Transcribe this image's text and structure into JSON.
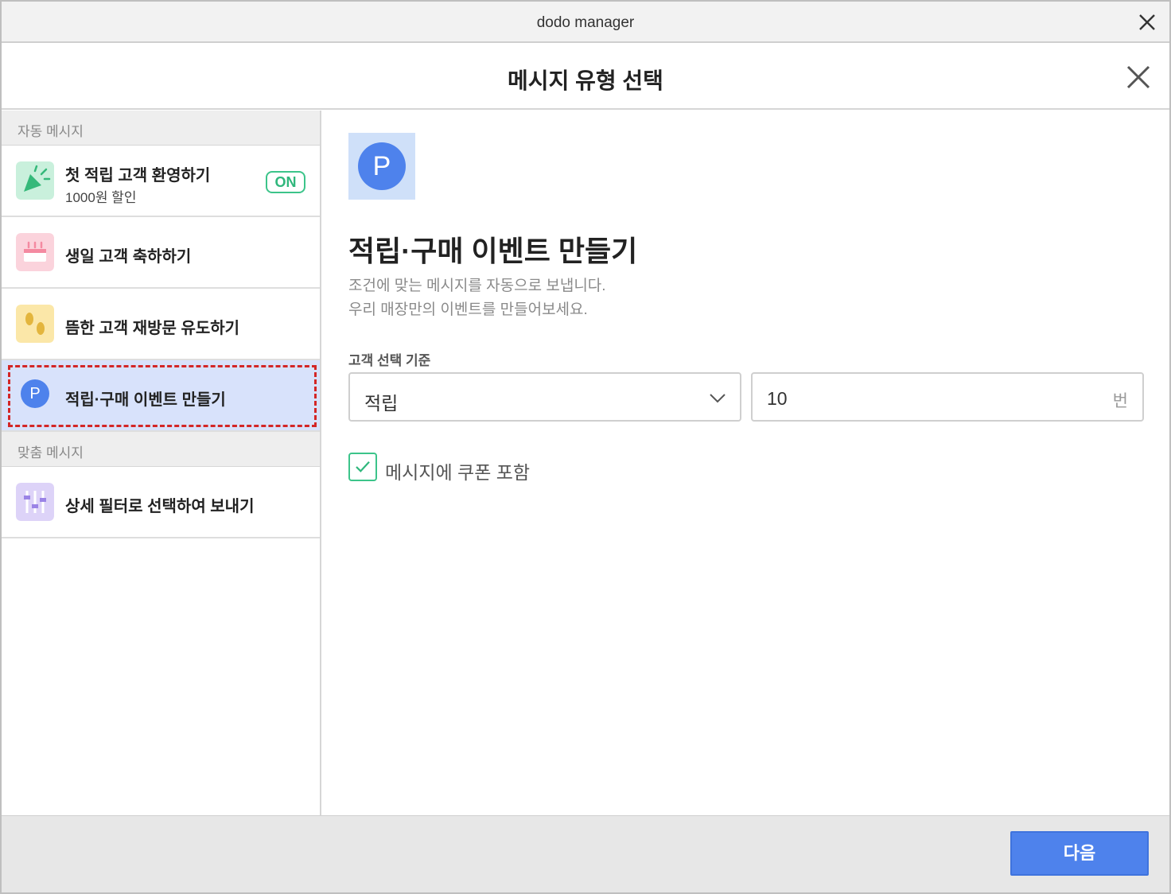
{
  "window": {
    "title": "dodo manager"
  },
  "dialog": {
    "title": "메시지 유형 선택"
  },
  "sidebar": {
    "auto_section": "자동 메시지",
    "custom_section": "맞춤 메시지",
    "items": [
      {
        "label": "첫 적립 고객 환영하기",
        "sub": "1000원 할인",
        "badge": "ON",
        "icon": "party-popper-icon"
      },
      {
        "label": "생일 고객 축하하기",
        "icon": "birthday-cake-icon"
      },
      {
        "label": "뜸한 고객 재방문 유도하기",
        "icon": "footprints-icon"
      },
      {
        "label": "적립·구매 이벤트 만들기",
        "icon": "point-p-icon",
        "icon_text": "P",
        "selected": true
      },
      {
        "label": "상세 필터로 선택하여 보내기",
        "icon": "sliders-icon"
      }
    ]
  },
  "main": {
    "icon_text": "P",
    "title": "적립·구매 이벤트 만들기",
    "desc_line1": "조건에 맞는 메시지를 자동으로 보냅니다.",
    "desc_line2": "우리 매장만의 이벤트를 만들어보세요.",
    "criteria_label": "고객 선택 기준",
    "criteria_value": "적립",
    "count_value": "10",
    "count_unit": "번",
    "coupon_label": "메시지에 쿠폰 포함",
    "coupon_checked": true
  },
  "footer": {
    "next_label": "다음"
  },
  "colors": {
    "accent": "#4e82ec",
    "success": "#3cc48a",
    "selected_bg": "#d8e2fb",
    "focus": "#d32626"
  }
}
